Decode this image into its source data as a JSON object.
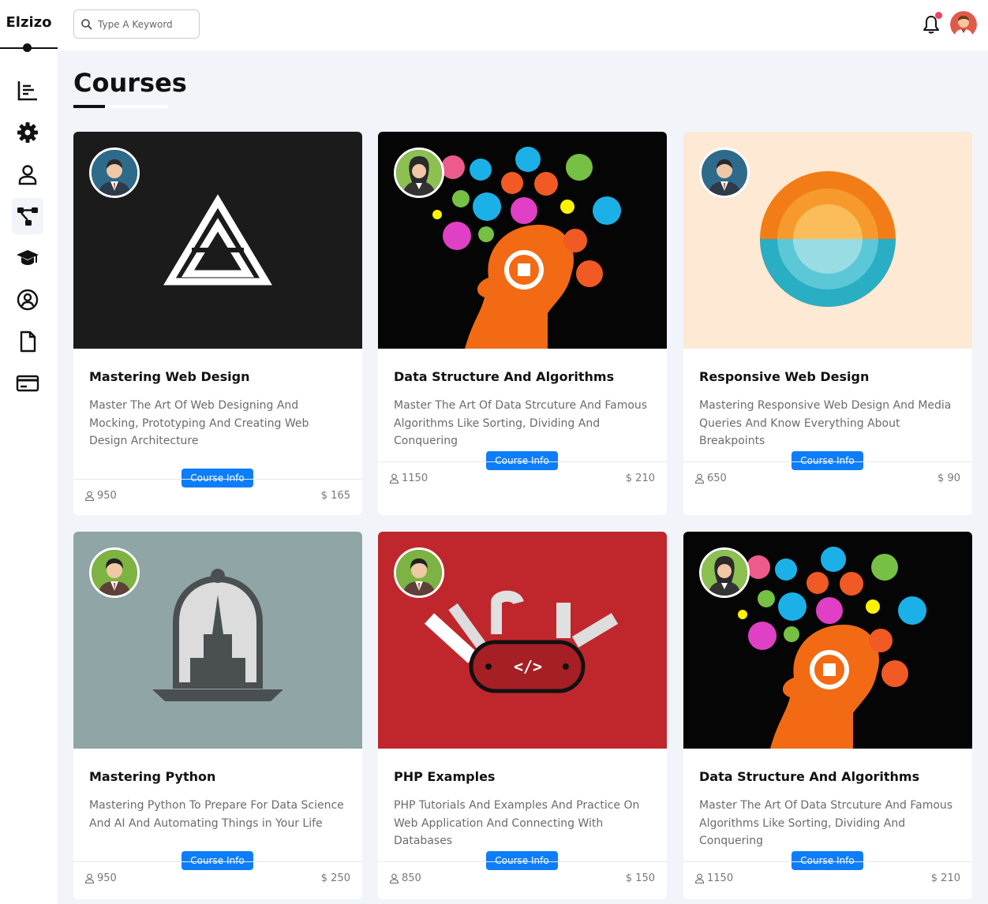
{
  "app": {
    "logo": "Elzizo"
  },
  "header": {
    "search_placeholder": "Type A Keyword"
  },
  "sidebar": {
    "items": [
      {
        "icon": "chart-icon"
      },
      {
        "icon": "gear-icon"
      },
      {
        "icon": "user-icon"
      },
      {
        "icon": "diagram-icon",
        "active": true
      },
      {
        "icon": "graduation-cap-icon"
      },
      {
        "icon": "user-circle-icon"
      },
      {
        "icon": "file-icon"
      },
      {
        "icon": "credit-card-icon"
      }
    ]
  },
  "page": {
    "title": "Courses"
  },
  "courses": [
    {
      "title": "Mastering Web Design",
      "description": "Master The Art Of Web Designing And Mocking, Prototyping And Creating Web Design Architecture",
      "button": "Course Info",
      "students": "950",
      "price": "$ 165"
    },
    {
      "title": "Data Structure And Algorithms",
      "description": "Master The Art Of Data Strcuture And Famous Algorithms Like Sorting, Dividing And Conquering",
      "button": "Course Info",
      "students": "1150",
      "price": "$ 210"
    },
    {
      "title": "Responsive Web Design",
      "description": "Mastering Responsive Web Design And Media Queries And Know Everything About Breakpoints",
      "button": "Course Info",
      "students": "650",
      "price": "$ 90"
    },
    {
      "title": "Mastering Python",
      "description": "Mastering Python To Prepare For Data Science And AI And Automating Things in Your Life",
      "button": "Course Info",
      "students": "950",
      "price": "$ 250"
    },
    {
      "title": "PHP Examples",
      "description": "PHP Tutorials And Examples And Practice On Web Application And Connecting With Databases",
      "button": "Course Info",
      "students": "850",
      "price": "$ 150"
    },
    {
      "title": "Data Structure And Algorithms",
      "description": "Master The Art Of Data Strcuture And Famous Algorithms Like Sorting, Dividing And Conquering",
      "button": "Course Info",
      "students": "1150",
      "price": "$ 210"
    }
  ],
  "colors": {
    "accent": "#0d7dfa",
    "notification": "#f43f5e",
    "background": "#f1f5f9"
  }
}
